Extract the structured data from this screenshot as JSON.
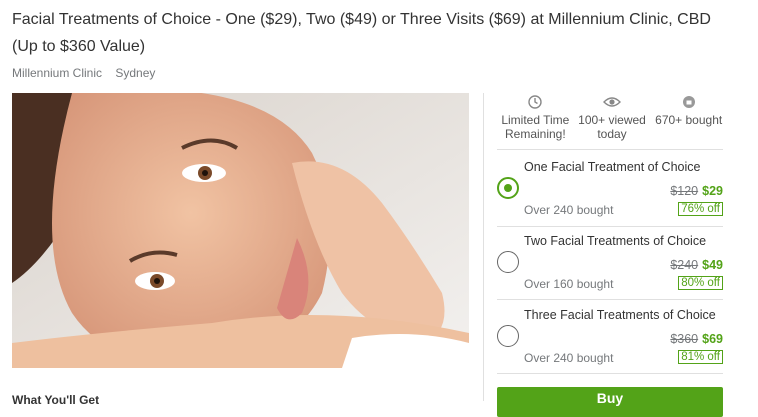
{
  "deal": {
    "title": "Facial Treatments of Choice - One ($29), Two ($49) or Three Visits ($69) at Millennium Clinic, CBD (Up to $360 Value)",
    "merchant": "Millennium Clinic",
    "location": "Sydney"
  },
  "stats": [
    {
      "icon": "clock-icon",
      "line1": "Limited Time",
      "line2": "Remaining!"
    },
    {
      "icon": "eye-icon",
      "line1": "100+ viewed",
      "line2": "today"
    },
    {
      "icon": "bag-icon",
      "line1": "670+ bought",
      "line2": ""
    }
  ],
  "options": [
    {
      "name": "One Facial Treatment of Choice",
      "bought": "Over 240 bought",
      "original": "$120",
      "price": "$29",
      "discount": "76% off",
      "selected": true
    },
    {
      "name": "Two Facial Treatments of Choice",
      "bought": "Over 160 bought",
      "original": "$240",
      "price": "$49",
      "discount": "80% off",
      "selected": false
    },
    {
      "name": "Three Facial Treatments of Choice",
      "bought": "Over 240 bought",
      "original": "$360",
      "price": "$69",
      "discount": "81% off",
      "selected": false
    }
  ],
  "buy_label": "Buy",
  "section_heading": "What You'll Get",
  "colors": {
    "accent": "#53a318",
    "muted": "#75787b"
  }
}
